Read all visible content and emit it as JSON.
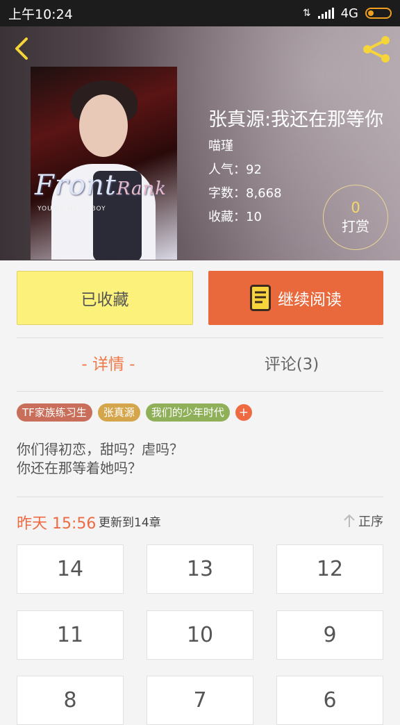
{
  "status_bar": {
    "time": "上午10:24",
    "network": "4G"
  },
  "book": {
    "title": "张真源:我还在那等你",
    "author": "喵瑾",
    "popularity": "人气：92",
    "word_count": "字数：8,668",
    "favorites": "收藏：10",
    "cover_text": {
      "line1": "Front",
      "line2": "Rank",
      "sub": "YOU'RE MY ... BOY"
    }
  },
  "tip": {
    "count": "0",
    "label": "打赏"
  },
  "actions": {
    "collected_label": "已收藏",
    "read_label": "继续阅读"
  },
  "tabs": {
    "detail": "- 详情 -",
    "comments": "评论(3)"
  },
  "tags": [
    {
      "label": "TF家族练习生",
      "color": "#c86e5a"
    },
    {
      "label": "张真源",
      "color": "#d4a54a"
    },
    {
      "label": "我们的少年时代",
      "color": "#8fb059"
    }
  ],
  "tag_add": "+",
  "description": [
    "你们得初恋，甜吗？虐吗？",
    "你还在那等着她吗？"
  ],
  "update": {
    "time": "昨天 15:56",
    "text": "更新到14章"
  },
  "sort_label": "正序",
  "chapters": [
    "14",
    "13",
    "12",
    "11",
    "10",
    "9",
    "8",
    "7",
    "6"
  ],
  "colors": {
    "accent": "#e9683c",
    "collected_bg": "#fcf17a"
  }
}
